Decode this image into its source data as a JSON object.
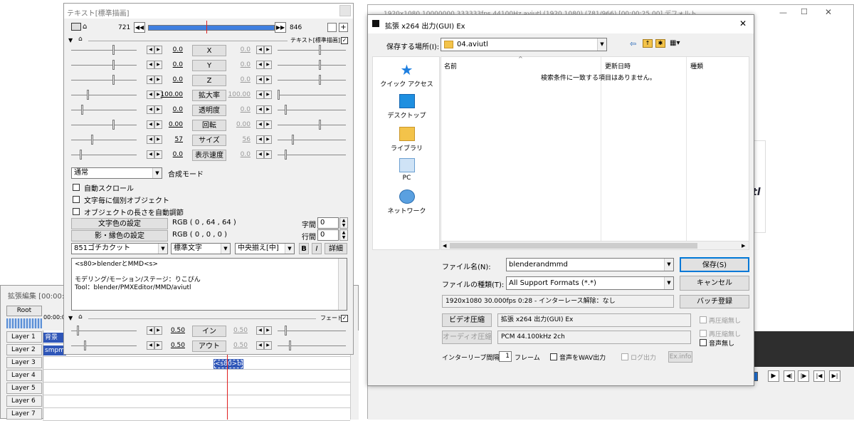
{
  "text_window": {
    "title": "テキスト[標準描画]",
    "frame_start": "721",
    "frame_end": "846",
    "object_label": "テキスト[標準描画]",
    "params": [
      {
        "left": "0.0",
        "name": "X",
        "right": "0.0"
      },
      {
        "left": "0.0",
        "name": "Y",
        "right": "0.0"
      },
      {
        "left": "0.0",
        "name": "Z",
        "right": "0.0"
      },
      {
        "left": "100.00",
        "name": "拡大率",
        "right": "100.00"
      },
      {
        "left": "0.0",
        "name": "透明度",
        "right": "0.0"
      },
      {
        "left": "0.00",
        "name": "回転",
        "right": "0.00"
      },
      {
        "left": "57",
        "name": "サイズ",
        "right": "56"
      },
      {
        "left": "0.0",
        "name": "表示速度",
        "right": "0.0"
      }
    ],
    "blend_mode_value": "通常",
    "blend_mode_label": "合成モード",
    "checkboxes": [
      "自動スクロール",
      "文字毎に個別オブジェクト",
      "オブジェクトの長さを自動調節"
    ],
    "text_color_button": "文字色の設定",
    "text_color_value": "RGB ( 0 , 64 , 64 )",
    "shadow_color_button": "影・縁色の設定",
    "shadow_color_value": "RGB ( 0 , 0 , 0 )",
    "char_spacing_label": "字間",
    "char_spacing_value": "0",
    "line_spacing_label": "行間",
    "line_spacing_value": "0",
    "font_value": "851ゴチカクット",
    "style_value": "標準文字",
    "align_value": "中央揃え[中]",
    "bold_label": "B",
    "italic_label": "I",
    "detail_button": "詳細",
    "text_lines": [
      "<s80>blenderとMMD<s>",
      "",
      "モデリング/モーション/ステージ：りこぴん",
      "Tool：blender/PMXEditor/MMD/aviutl"
    ],
    "fade_label": "フェード",
    "fade_params": [
      {
        "left": "0.50",
        "name": "イン",
        "right": "0.50"
      },
      {
        "left": "0.50",
        "name": "アウト",
        "right": "0.50"
      }
    ]
  },
  "timeline": {
    "title": "拡張編集 [00:00:0",
    "root_label": "Root",
    "time_label": "00:00:00",
    "layers": [
      "Layer 1",
      "Layer 2",
      "Layer 3",
      "Layer 4",
      "Layer 5",
      "Layer 6",
      "Layer 7"
    ],
    "clip1": "背景(画",
    "clip2": "smpmd",
    "clip3": "<s80>bl"
  },
  "main_window": {
    "title": "1920x1080  10000000  333333fps  44100Hz  aviutl (1920,1080)  (781/966) [00:00:25.00]  デフォルト"
  },
  "dialog": {
    "title": "拡張 x264 出力(GUI) Ex",
    "save_location_label": "保存する場所(I):",
    "save_location_value": "04.aviutl",
    "nav_items": [
      "クイック アクセス",
      "デスクトップ",
      "ライブラリ",
      "PC",
      "ネットワーク"
    ],
    "columns": [
      "名前",
      "更新日時",
      "種類"
    ],
    "empty_message": "検索条件に一致する項目はありません。",
    "filename_label": "ファイル名(N):",
    "filename_value": "blenderandmmd",
    "filetype_label": "ファイルの種類(T):",
    "filetype_value": "All Support Formats (*.*)",
    "save_button": "保存(S)",
    "cancel_button": "キャンセル",
    "info": "1920x1080  30.000fps  0:28  -  インターレース解除：なし",
    "batch_button": "バッチ登録",
    "video_button": "ビデオ圧縮",
    "video_value": "拡張 x264 出力(GUI) Ex",
    "recompress_label": "再圧縮無し",
    "audio_button": "オーディオ圧縮",
    "audio_value": "PCM 44.100kHz 2ch",
    "recompress2_label": "再圧縮無し",
    "no_audio_label": "音声無し",
    "interleave_label": "インターリーブ間隔：",
    "interleave_value": "1",
    "frame_label": "フレーム",
    "wav_label": "音声をWAV出力",
    "log_label": "ログ出力",
    "exinfo_button": "Ex.info"
  },
  "main_bg_text": "tl"
}
